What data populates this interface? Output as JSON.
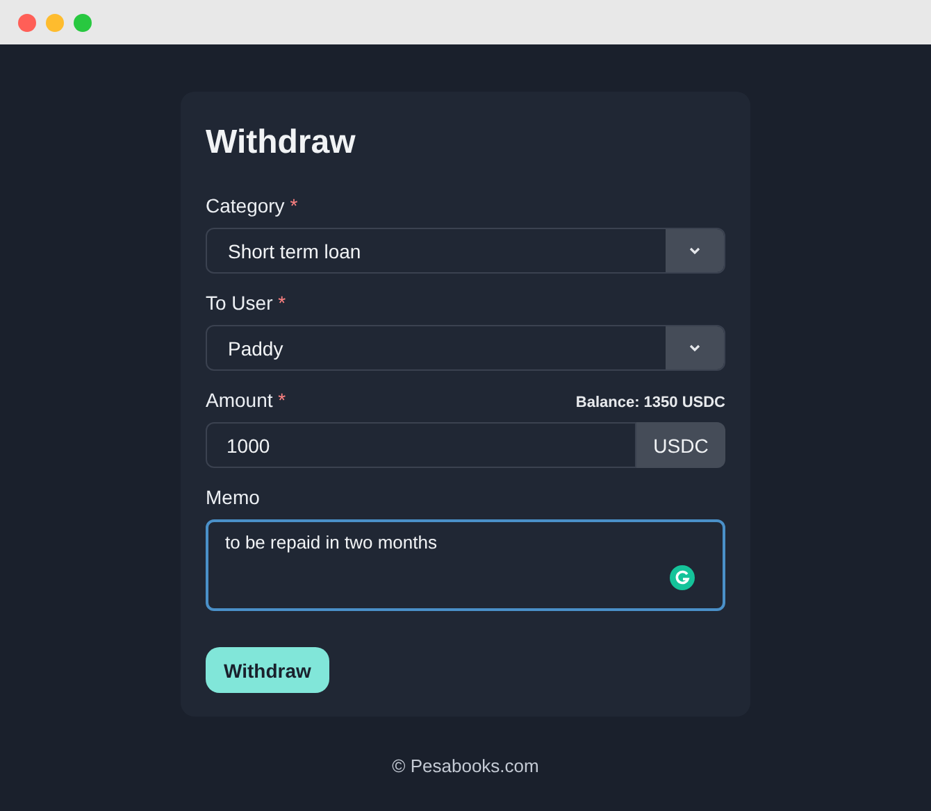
{
  "form": {
    "title": "Withdraw",
    "fields": [
      {
        "kind": "select",
        "label": "Category",
        "required_mark": "*",
        "value": "Short term loan"
      },
      {
        "kind": "select",
        "label": "To User",
        "required_mark": "*",
        "value": "Paddy"
      },
      {
        "kind": "amount",
        "label": "Amount",
        "required_mark": "*",
        "balance": "Balance: 1350 USDC",
        "value": "1000",
        "unit": "USDC"
      },
      {
        "kind": "memo",
        "label": "Memo",
        "value": "to be repaid in two months",
        "focused": true
      }
    ],
    "submit": "Withdraw"
  },
  "footer": "© Pesabooks.com"
}
